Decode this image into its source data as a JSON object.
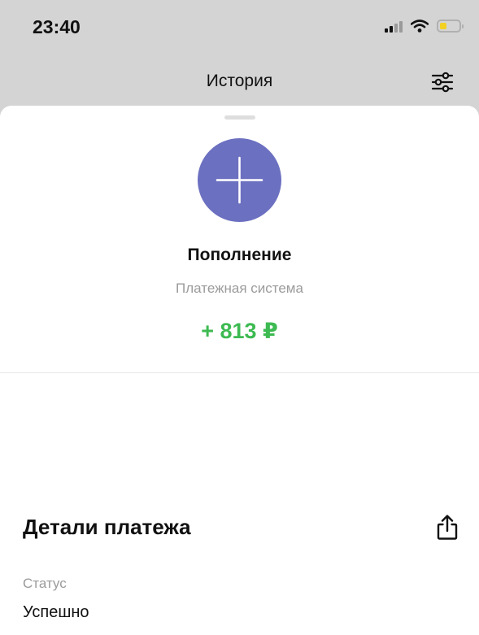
{
  "status_bar": {
    "time": "23:40",
    "battery_fill_fraction": 0.3,
    "battery_color": "#f2d024"
  },
  "nav": {
    "title": "История",
    "filter_icon": "sliders-icon"
  },
  "transaction": {
    "icon": "plus-icon",
    "icon_color": "#6c70c0",
    "title": "Пополнение",
    "subtitle": "Платежная система",
    "amount": "+ 813 ₽",
    "amount_color": "#3dba52"
  },
  "details": {
    "title": "Детали платежа",
    "share_icon": "share-icon",
    "status_label": "Статус",
    "status_value": "Успешно"
  }
}
